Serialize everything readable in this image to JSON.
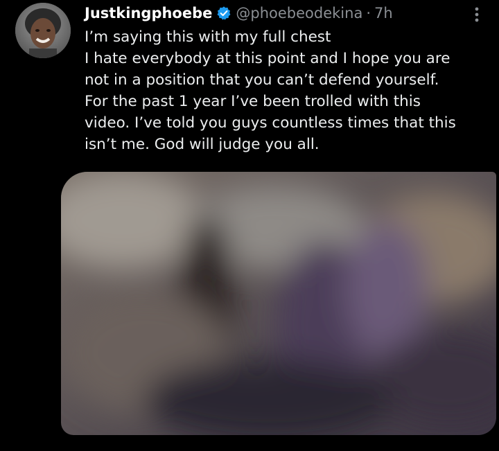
{
  "tweet": {
    "display_name": "Justkingphoebe",
    "handle": "@phoebeodekina",
    "separator": "·",
    "time": "7h",
    "text_lines": [
      "I’m saying this with my full chest",
      "I hate everybody at this point and I hope you are",
      "not in a position that you can’t defend yourself.",
      "For the past 1 year I’ve been trolled with this",
      "video. I’ve told you guys countless times that this",
      "isn’t me. God will judge you all."
    ]
  },
  "icons": {
    "verified": "verified-badge-icon",
    "more": "more-options-icon",
    "avatar": "profile-avatar"
  },
  "colors": {
    "background": "#000000",
    "text": "#e7e9ea",
    "secondary": "#8b8f94",
    "verified": "#1d9bf0"
  }
}
